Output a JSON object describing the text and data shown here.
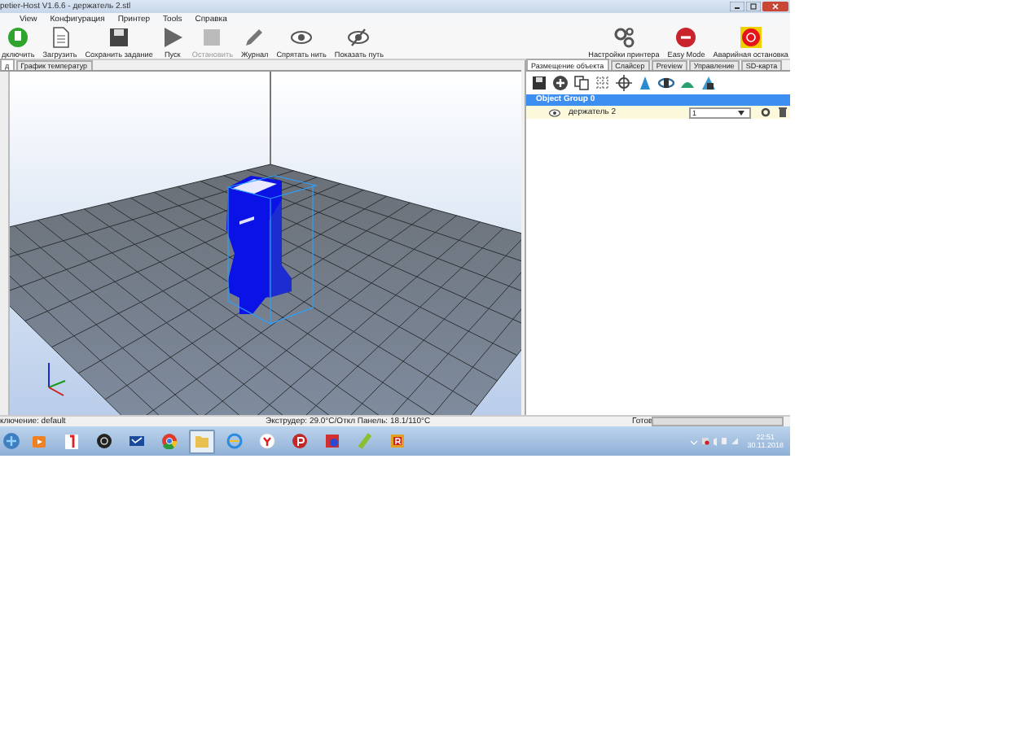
{
  "window": {
    "title": "petier-Host V1.6.6 - держатель 2.stl"
  },
  "menu": [
    "View",
    "Конфигурация",
    "Принтер",
    "Tools",
    "Справка"
  ],
  "toolbar": [
    {
      "kind": "plug",
      "label": "дключить",
      "disabled": false
    },
    {
      "kind": "document",
      "label": "Загрузить",
      "disabled": false
    },
    {
      "kind": "floppy",
      "label": "Сохранить задание",
      "disabled": false
    },
    {
      "kind": "play",
      "label": "Пуск",
      "disabled": false
    },
    {
      "kind": "stop",
      "label": "Остановить",
      "disabled": true
    },
    {
      "kind": "pencil",
      "label": "Журнал",
      "disabled": false
    },
    {
      "kind": "eye",
      "label": "Спрятать нить",
      "disabled": false
    },
    {
      "kind": "eyeslash",
      "label": "Показать путь",
      "disabled": false
    }
  ],
  "toolbar_right": [
    {
      "kind": "gears",
      "label": "Настройки принтера"
    },
    {
      "kind": "badge",
      "label": "Easy Mode"
    },
    {
      "kind": "emergency",
      "label": "Аварийная остановка"
    }
  ],
  "left_tabs": [
    {
      "label": "д",
      "selected": true
    },
    {
      "label": "График температур",
      "selected": false
    }
  ],
  "right_tabs": [
    {
      "label": "Размещение объекта",
      "selected": true
    },
    {
      "label": "Слайсер",
      "selected": false
    },
    {
      "label": "Preview",
      "selected": false
    },
    {
      "label": "Управление",
      "selected": false
    },
    {
      "label": "SD-карта",
      "selected": false
    }
  ],
  "object_tree": {
    "name": "Object Group 0",
    "selected": true,
    "children": [
      {
        "name": "держатель 2",
        "copies": "1",
        "visible": true
      }
    ]
  },
  "status_bar": {
    "connection": "ключение: default",
    "temperatures": "Экструдер: 29.0°C/Откл Панель: 18.1/110°C",
    "status": "Готов",
    "level": 0
  },
  "taskbar": {
    "apps": [
      {
        "kind": "media",
        "selected": false
      },
      {
        "kind": "yandex",
        "selected": false
      },
      {
        "kind": "dark",
        "selected": false
      },
      {
        "kind": "mail",
        "selected": false
      },
      {
        "kind": "chrome",
        "selected": false
      },
      {
        "kind": "folder",
        "selected": true
      },
      {
        "kind": "ie",
        "selected": false
      },
      {
        "kind": "ybrowser",
        "selected": false
      },
      {
        "kind": "pbadge",
        "selected": false
      },
      {
        "kind": "gearapp",
        "selected": false
      },
      {
        "kind": "green",
        "selected": false
      },
      {
        "kind": "rcube",
        "selected": false
      }
    ],
    "time": "22:51",
    "date": "30.11.2018"
  }
}
